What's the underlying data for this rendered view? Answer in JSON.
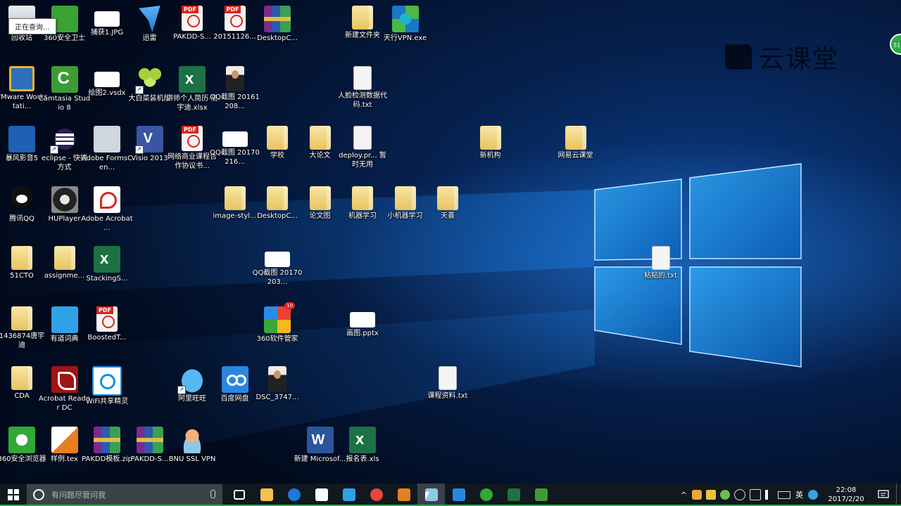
{
  "desktop": {
    "tooltip": "正在查询...",
    "watermark": "云课堂",
    "badge": "51",
    "icons": [
      {
        "label": "回收站",
        "icon": "recycle-bin-icon",
        "cls": "recycle",
        "col": 0,
        "row": 0,
        "shortcut": false
      },
      {
        "label": "360安全卫士",
        "icon": "360-safe-icon",
        "cls": "app-green",
        "col": 1,
        "row": 0,
        "shortcut": false
      },
      {
        "label": "捕获1.JPG",
        "icon": "image-file-icon",
        "cls": "img-thumb",
        "col": 2,
        "row": 0,
        "shortcut": false
      },
      {
        "label": "迅雷",
        "icon": "xunlei-icon",
        "cls": "xunlei",
        "col": 3,
        "row": 0,
        "shortcut": true
      },
      {
        "label": "PAKDD-S...",
        "icon": "pdf-icon",
        "cls": "pdf",
        "col": 4,
        "row": 0,
        "shortcut": false
      },
      {
        "label": "20151126...",
        "icon": "pdf-icon",
        "cls": "pdf",
        "col": 5,
        "row": 0,
        "shortcut": false
      },
      {
        "label": "DesktopC...",
        "icon": "archive-icon",
        "cls": "rar",
        "col": 6,
        "row": 0,
        "shortcut": false
      },
      {
        "label": "新建文件夹",
        "icon": "folder-icon",
        "cls": "folder",
        "col": 8,
        "row": 0,
        "shortcut": false
      },
      {
        "label": "天行VPN.exe",
        "icon": "vpn-app-icon",
        "cls": "vpn-fan",
        "col": 9,
        "row": 0,
        "shortcut": false
      },
      {
        "label": "VMware Workstati...",
        "icon": "vmware-icon",
        "cls": "vm",
        "col": 0,
        "row": 1,
        "shortcut": false
      },
      {
        "label": "Camtasia Studio 8",
        "icon": "camtasia-icon",
        "cls": "camtasia",
        "col": 1,
        "row": 1,
        "shortcut": false
      },
      {
        "label": "绘图2.vsdx",
        "icon": "visio-file-icon",
        "cls": "img-thumb",
        "col": 2,
        "row": 1,
        "shortcut": false
      },
      {
        "label": "大白菜装机版",
        "icon": "broccoli-icon",
        "cls": "broccoli",
        "col": 3,
        "row": 1,
        "shortcut": true
      },
      {
        "label": "讲师个人简历-唐宇迪.xlsx",
        "icon": "excel-file-icon",
        "cls": "xls",
        "col": 4,
        "row": 1,
        "shortcut": false
      },
      {
        "label": "QQ截图 20161208...",
        "icon": "photo-icon",
        "cls": "photo",
        "col": 5,
        "row": 1,
        "shortcut": false
      },
      {
        "label": "人脸检测数据代码.txt",
        "icon": "text-file-icon",
        "cls": "doc",
        "col": 8,
        "row": 1,
        "shortcut": false
      },
      {
        "label": "暴风影音5",
        "icon": "baofeng-icon",
        "cls": "baofeng",
        "col": 0,
        "row": 2,
        "shortcut": false
      },
      {
        "label": "eclipse - 快捷方式",
        "icon": "eclipse-icon",
        "cls": "eclipse",
        "col": 1,
        "row": 2,
        "shortcut": true
      },
      {
        "label": "Adobe FormsCen...",
        "icon": "adobe-forms-icon",
        "cls": "app-gray",
        "col": 2,
        "row": 2,
        "shortcut": false
      },
      {
        "label": "Visio 2013",
        "icon": "visio-icon",
        "cls": "visio",
        "col": 3,
        "row": 2,
        "shortcut": true
      },
      {
        "label": "网络商业课程合作协议书...",
        "icon": "pdf-icon",
        "cls": "pdf",
        "col": 4,
        "row": 2,
        "shortcut": false
      },
      {
        "label": "QQ截图 20170216...",
        "icon": "image-file-icon",
        "cls": "img-thumb",
        "col": 5,
        "row": 2,
        "shortcut": false
      },
      {
        "label": "学校",
        "icon": "folder-icon",
        "cls": "folder",
        "col": 6,
        "row": 2,
        "shortcut": false
      },
      {
        "label": "大论文",
        "icon": "folder-icon",
        "cls": "folder",
        "col": 7,
        "row": 2,
        "shortcut": false
      },
      {
        "label": "deploy.pr... 暂时无用",
        "icon": "text-file-icon",
        "cls": "doc",
        "col": 8,
        "row": 2,
        "shortcut": false
      },
      {
        "label": "新机构",
        "icon": "folder-icon",
        "cls": "folder",
        "col": 11,
        "row": 2,
        "shortcut": false
      },
      {
        "label": "网易云课堂",
        "icon": "folder-icon",
        "cls": "folder",
        "col": 13,
        "row": 2,
        "shortcut": false
      },
      {
        "label": "腾讯QQ",
        "icon": "qq-icon",
        "cls": "qq",
        "col": 0,
        "row": 3,
        "shortcut": false
      },
      {
        "label": "HUPlayer",
        "icon": "huplayer-icon",
        "cls": "hu",
        "col": 1,
        "row": 3,
        "shortcut": false
      },
      {
        "label": "Adobe Acrobat ...",
        "icon": "acrobat-icon",
        "cls": "adobe",
        "col": 2,
        "row": 3,
        "shortcut": false
      },
      {
        "label": "image-styl...",
        "icon": "folder-icon",
        "cls": "folder",
        "col": 5,
        "row": 3,
        "shortcut": false
      },
      {
        "label": "DesktopC...",
        "icon": "folder-icon",
        "cls": "folder",
        "col": 6,
        "row": 3,
        "shortcut": false
      },
      {
        "label": "论文图",
        "icon": "folder-icon",
        "cls": "folder",
        "col": 7,
        "row": 3,
        "shortcut": false
      },
      {
        "label": "机器学习",
        "icon": "folder-icon",
        "cls": "folder",
        "col": 8,
        "row": 3,
        "shortcut": false
      },
      {
        "label": "小机器学习",
        "icon": "folder-icon",
        "cls": "folder",
        "col": 9,
        "row": 3,
        "shortcut": false
      },
      {
        "label": "天善",
        "icon": "folder-icon",
        "cls": "folder",
        "col": 10,
        "row": 3,
        "shortcut": false
      },
      {
        "label": "51CTO",
        "icon": "folder-icon",
        "cls": "folder",
        "col": 0,
        "row": 4,
        "shortcut": false
      },
      {
        "label": "assignme...",
        "icon": "folder-icon",
        "cls": "folder",
        "col": 1,
        "row": 4,
        "shortcut": false
      },
      {
        "label": "StackingS...",
        "icon": "excel-file-icon",
        "cls": "xls",
        "col": 2,
        "row": 4,
        "shortcut": false
      },
      {
        "label": "QQ截图 20170203...",
        "icon": "image-file-icon",
        "cls": "img-thumb",
        "col": 6,
        "row": 4,
        "shortcut": false
      },
      {
        "label": "粘贴的.txt",
        "icon": "text-file-icon",
        "cls": "doc",
        "col": 15,
        "row": 4,
        "shortcut": false
      },
      {
        "label": "1436874唐宇迪",
        "icon": "folder-icon",
        "cls": "folder",
        "col": 0,
        "row": 5,
        "shortcut": false
      },
      {
        "label": "有道词典",
        "icon": "youdao-icon",
        "cls": "youdao",
        "col": 1,
        "row": 5,
        "shortcut": false
      },
      {
        "label": "BoostedT...",
        "icon": "pdf-icon",
        "cls": "pdf",
        "col": 2,
        "row": 5,
        "shortcut": false
      },
      {
        "label": "360软件管家",
        "icon": "360-manager-icon",
        "cls": "mgr360",
        "col": 6,
        "row": 5,
        "shortcut": false
      },
      {
        "label": "画图.pptx",
        "icon": "pptx-file-icon",
        "cls": "img-thumb",
        "col": 8,
        "row": 5,
        "shortcut": false
      },
      {
        "label": "CDA",
        "icon": "folder-icon",
        "cls": "folder",
        "col": 0,
        "row": 6,
        "shortcut": false
      },
      {
        "label": "Acrobat Reader DC",
        "icon": "acrobat-reader-icon",
        "cls": "app-red",
        "col": 1,
        "row": 6,
        "shortcut": false
      },
      {
        "label": "WiFi共享精灵",
        "icon": "wifi-share-icon",
        "cls": "wifi",
        "col": 2,
        "row": 6,
        "shortcut": false
      },
      {
        "label": "阿里旺旺",
        "icon": "wangwang-icon",
        "cls": "wangwang",
        "col": 4,
        "row": 6,
        "shortcut": true
      },
      {
        "label": "百度网盘",
        "icon": "baidu-netdisk-icon",
        "cls": "baidu",
        "col": 5,
        "row": 6,
        "shortcut": false
      },
      {
        "label": "DSC_3747...",
        "icon": "photo-icon",
        "cls": "photo",
        "col": 6,
        "row": 6,
        "shortcut": false
      },
      {
        "label": "课程资料.txt",
        "icon": "text-file-icon",
        "cls": "doc",
        "col": 10,
        "row": 6,
        "shortcut": false
      },
      {
        "label": "360安全浏览器",
        "icon": "360-browser-icon",
        "cls": "net360",
        "col": 0,
        "row": 7,
        "shortcut": false
      },
      {
        "label": "样例.tex",
        "icon": "tex-file-icon",
        "cls": "pen",
        "col": 1,
        "row": 7,
        "shortcut": false
      },
      {
        "label": "PAKDD模板.zip",
        "icon": "archive-icon",
        "cls": "rar",
        "col": 2,
        "row": 7,
        "shortcut": false
      },
      {
        "label": "PAKDD-S...",
        "icon": "archive-icon",
        "cls": "rar",
        "col": 3,
        "row": 7,
        "shortcut": false
      },
      {
        "label": "BNU SSL VPN",
        "icon": "bnu-vpn-icon",
        "cls": "bnu",
        "col": 4,
        "row": 7,
        "shortcut": false
      },
      {
        "label": "新建 Microsof...",
        "icon": "word-file-icon",
        "cls": "word",
        "col": 7,
        "row": 7,
        "shortcut": false
      },
      {
        "label": "报名表.xls",
        "icon": "excel-file-icon",
        "cls": "xls",
        "col": 8,
        "row": 7,
        "shortcut": false
      }
    ]
  },
  "taskbar": {
    "search_placeholder": "有问题尽管问我",
    "pinned": [
      {
        "name": "task-view-button",
        "icon": "task-view-icon",
        "color": "#ffffff",
        "open": false,
        "active": false
      },
      {
        "name": "file-explorer-button",
        "icon": "folder-icon",
        "color": "#f2c14e",
        "open": false,
        "active": false
      },
      {
        "name": "edge-button",
        "icon": "edge-icon",
        "color": "#1e78d6",
        "open": false,
        "active": false
      },
      {
        "name": "store-button",
        "icon": "store-icon",
        "color": "#ffffff",
        "open": false,
        "active": false
      },
      {
        "name": "youdao-taskbar-button",
        "icon": "youdao-icon",
        "color": "#2ea1e8",
        "open": false,
        "active": false
      },
      {
        "name": "chrome-button",
        "icon": "chrome-icon",
        "color": "#e9453a",
        "open": false,
        "active": false
      },
      {
        "name": "eclipse-taskbar-button",
        "icon": "eclipse-icon",
        "color": "#e67e22",
        "open": false,
        "active": false
      },
      {
        "name": "bnu-vpn-taskbar-button",
        "icon": "bnu-vpn-icon",
        "color": "#8ec7e8",
        "open": true,
        "active": true
      },
      {
        "name": "baidu-taskbar-button",
        "icon": "baidu-netdisk-icon",
        "color": "#2b86e0",
        "open": false,
        "active": false
      },
      {
        "name": "360-taskbar-button",
        "icon": "360-browser-icon",
        "color": "#32a836",
        "open": false,
        "active": false
      },
      {
        "name": "excel-taskbar-button",
        "icon": "excel-icon",
        "color": "#1e7145",
        "open": false,
        "active": false
      },
      {
        "name": "camtasia-taskbar-button",
        "icon": "camtasia-icon",
        "color": "#3d9c36",
        "open": false,
        "active": false
      }
    ],
    "tray": {
      "ime": "英",
      "time": "22:08",
      "date": "2017/2/20"
    }
  }
}
